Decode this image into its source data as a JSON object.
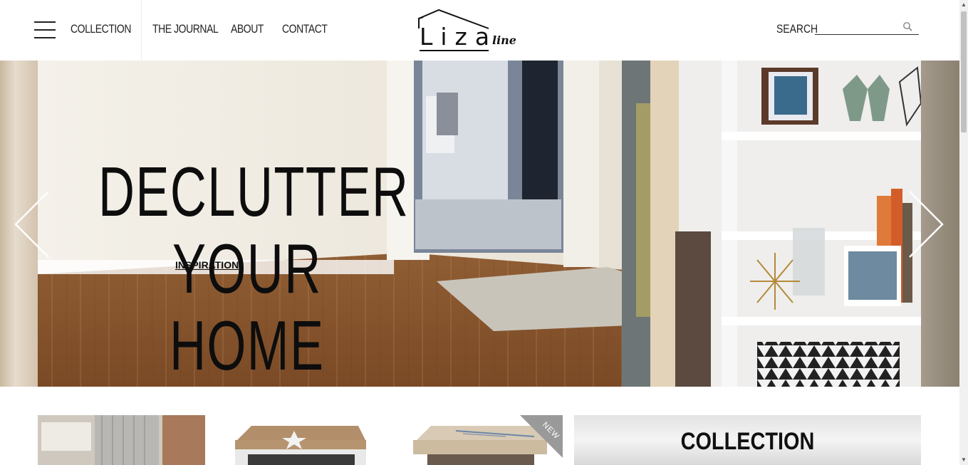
{
  "header": {
    "nav": [
      "COLLECTION",
      "THE JOURNAL",
      "ABOUT",
      "CONTACT"
    ],
    "logo": {
      "main": "Liza",
      "sub": "line"
    },
    "search": {
      "label": "SEARCH",
      "value": "",
      "placeholder": ""
    }
  },
  "hero": {
    "title_line1": "DECLUTTER",
    "title_line2": "YOUR HOME",
    "link": "INSPIRATION"
  },
  "products": {
    "badge": "NEW",
    "collection_tile": "COLLECTION"
  },
  "icons": [
    "menu-icon",
    "search-icon",
    "arrow-left-icon",
    "arrow-right-icon"
  ],
  "colors": {
    "text": "#111111",
    "background": "#ffffff",
    "badge": "#9a9a9a"
  }
}
